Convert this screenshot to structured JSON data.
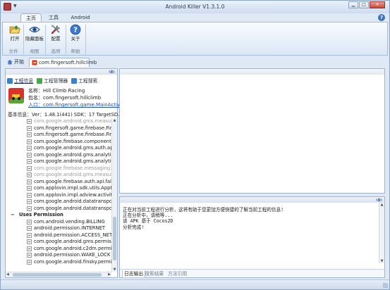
{
  "window": {
    "title": "Android Killer V1.3.1.0"
  },
  "ribbon_tabs": [
    "主页",
    "工具",
    "Android"
  ],
  "ribbon": {
    "buttons": [
      {
        "label": "打开",
        "icon": "folder-open-icon"
      },
      {
        "label": "隐藏面板",
        "icon": "eye-icon"
      },
      {
        "label": "配置",
        "icon": "tools-icon"
      },
      {
        "label": "关于",
        "icon": "help-icon"
      }
    ],
    "groups": [
      "文件",
      "视图",
      "选项",
      "帮助"
    ]
  },
  "doc_tabs": {
    "home": "开始",
    "project": "com.fingersoft.hillclimb"
  },
  "left_panel": {
    "tabs": [
      "工程信息",
      "工程管理器",
      "工程搜索"
    ],
    "app": {
      "name_line": "名称：Hill Climb Racing",
      "package_line": "包名：com.fingersoft.hillclimb",
      "entry_line": "入口：com.fingersoft.game.MainActivi...",
      "base_line": "基本信息：Ver：1.48.1(441) SDK：17 TargetSD..."
    },
    "tree": [
      {
        "text": "com.google.android.gms.measure",
        "dim": true
      },
      {
        "text": "com.fingersoft.game.firebase.Firel",
        "dim": false
      },
      {
        "text": "com.fingersoft.game.firebase.Firel",
        "dim": false
      },
      {
        "text": "com.google.firebase.components.",
        "dim": false
      },
      {
        "text": "com.google.android.gms.auth.api.",
        "dim": false
      },
      {
        "text": "com.google.android.gms.analytics",
        "dim": false
      },
      {
        "text": "com.google.android.gms.analytics",
        "dim": false
      },
      {
        "text": "com.google.firebase.messaging.Fi",
        "dim": true
      },
      {
        "text": "com.google.android.gms.measure",
        "dim": true
      },
      {
        "text": "com.google.firebase.auth.api.fallb",
        "dim": false
      },
      {
        "text": "com.applovin.impl.sdk.utils.AppKil",
        "dim": false
      },
      {
        "text": "com.applovin.impl.adview.activity.F",
        "dim": false
      },
      {
        "text": "com.google.android.datatranspor",
        "dim": false
      },
      {
        "text": "com.google.android.datatranspor",
        "dim": false
      }
    ],
    "permissions_group": "Uses Permission",
    "permissions": [
      "com.android.vending.BILLING",
      "android.permission.INTERNET",
      "android.permission.ACCESS_NETW",
      "com.google.android.gms.permissi",
      "com.google.android.c2dm.permiss",
      "android.permission.WAKE_LOCK",
      "com.google.android.finsky.permis"
    ]
  },
  "log": {
    "lines": [
      "正在对当前工程进行分析，这将有助于您更加方便快捷的了解当前工程的信息!",
      "正在分析中，请稍等...",
      "该 APK 基于 Cocos2D",
      "分析完成!"
    ],
    "tabs": [
      "日志输出",
      "搜索结果",
      "方法引用"
    ]
  },
  "colors": {
    "accent": "#1a4cc8",
    "chrome": "#dfe9f5",
    "border": "#9fb4cf"
  }
}
